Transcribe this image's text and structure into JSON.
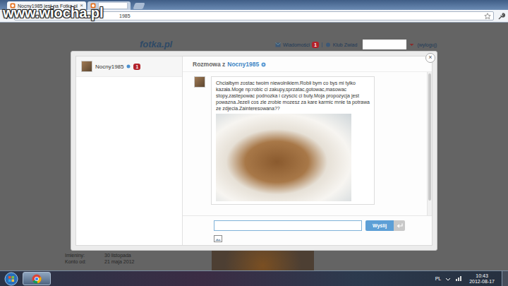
{
  "watermark": "www.wiocha.pl",
  "browser": {
    "tabs": [
      {
        "label": "Nocny1985 jest na Fotka.pl",
        "close": "×",
        "selected": true
      },
      {
        "selected": false,
        "redacted": true
      }
    ],
    "address": "1985"
  },
  "page": {
    "logo": "fotka.pl",
    "nav": [
      {
        "label": "Wiadomości",
        "badge": "1"
      },
      {
        "label": "Klub Zwiad"
      }
    ],
    "user_redacted": true,
    "logout": "(wyloguj)",
    "profile": [
      {
        "label": "Imieniny:",
        "value": "30 listopada"
      },
      {
        "label": "Konto od:",
        "value": "21 maja 2012"
      }
    ]
  },
  "dialog": {
    "close": "×",
    "contacts": [
      {
        "name": "Nocny1985",
        "badge": "1",
        "selected": true
      }
    ],
    "title": "Rozmowa z",
    "title_user": "Nocny1985",
    "messages": [
      {
        "text": "Chciałbym zostac twoim niewolnikiem.Robił bym co bys mi tylko kazała.Moge np:robic ci zakupy,sprzatac,gotowac,masowac stopy,zastepowac podnozka i czyscic ci buty.Moja propozycja jest powazna.Jezeli cos zle zrobie mozesz za kare karmic mnie ta potrawa ze zdjecia.Zainteresowana??",
        "photo": true
      }
    ],
    "send": "Wyślij"
  },
  "taskbar": {
    "language": "PL",
    "time": "10:43",
    "date": "2012-08-17"
  }
}
